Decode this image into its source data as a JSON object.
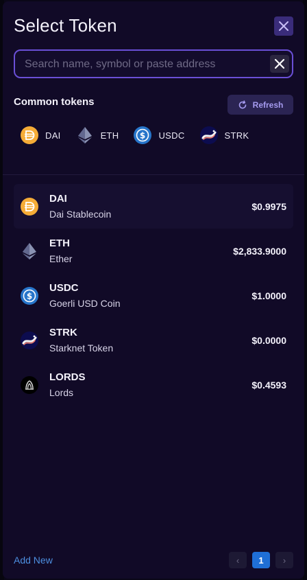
{
  "modal": {
    "title": "Select Token"
  },
  "search": {
    "placeholder": "Search name, symbol or paste address",
    "value": ""
  },
  "common": {
    "label": "Common tokens",
    "refresh_label": "Refresh",
    "chips": [
      {
        "symbol": "DAI",
        "icon": "dai-icon"
      },
      {
        "symbol": "ETH",
        "icon": "eth-icon"
      },
      {
        "symbol": "USDC",
        "icon": "usdc-icon"
      },
      {
        "symbol": "STRK",
        "icon": "strk-icon"
      }
    ]
  },
  "tokens": [
    {
      "symbol": "DAI",
      "name": "Dai Stablecoin",
      "price": "$0.9975",
      "icon": "dai-icon"
    },
    {
      "symbol": "ETH",
      "name": "Ether",
      "price": "$2,833.9000",
      "icon": "eth-icon"
    },
    {
      "symbol": "USDC",
      "name": "Goerli USD Coin",
      "price": "$1.0000",
      "icon": "usdc-icon"
    },
    {
      "symbol": "STRK",
      "name": "Starknet Token",
      "price": "$0.0000",
      "icon": "strk-icon"
    },
    {
      "symbol": "LORDS",
      "name": "Lords",
      "price": "$0.4593",
      "icon": "lords-icon"
    }
  ],
  "footer": {
    "add_new": "Add New",
    "current_page": "1",
    "prev_symbol": "‹",
    "next_symbol": "›"
  },
  "colors": {
    "accent": "#6a4fd6",
    "modal_bg": "#110a27",
    "link": "#4d8fe0",
    "active_page": "#1f6fd6"
  }
}
